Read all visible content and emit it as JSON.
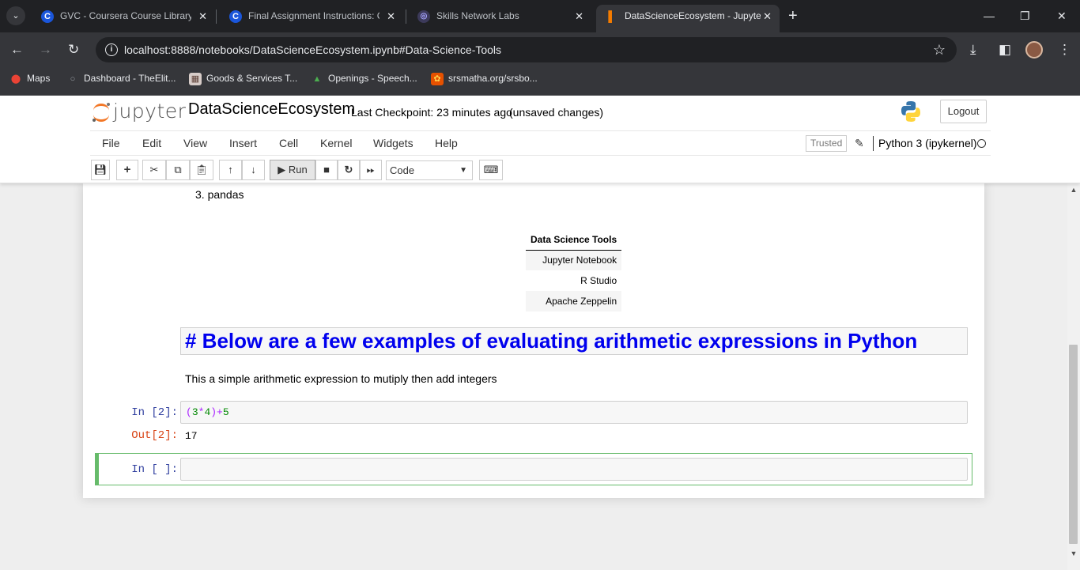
{
  "browser": {
    "tabs": [
      {
        "title": "GVC - Coursera Course Library |",
        "icon": "coursera-icon",
        "icon_glyph": "C"
      },
      {
        "title": "Final Assignment Instructions: C",
        "icon": "coursera-icon",
        "icon_glyph": "C"
      },
      {
        "title": "Skills Network Labs",
        "icon": "skills-network-icon",
        "icon_glyph": "◎"
      },
      {
        "title": "DataScienceEcosystem - Jupyter",
        "icon": "jupyter-tab-icon",
        "icon_glyph": "▌"
      }
    ],
    "url": "localhost:8888/notebooks/DataScienceEcosystem.ipynb#Data-Science-Tools",
    "bookmarks": [
      {
        "label": "Maps",
        "icon": "maps-icon"
      },
      {
        "label": "Dashboard - TheElit...",
        "icon": "search-icon"
      },
      {
        "label": "Goods & Services T...",
        "icon": "gst-icon"
      },
      {
        "label": "Openings - Speech...",
        "icon": "openings-icon"
      },
      {
        "label": "srsmatha.org/srsbo...",
        "icon": "srsmatha-icon"
      }
    ]
  },
  "jupyter": {
    "logo_text": "jupyter",
    "notebook_name": "DataScienceEcosystem",
    "checkpoint": "Last Checkpoint: 23 minutes ago",
    "autosave": "(unsaved changes)",
    "logout": "Logout",
    "menu": [
      "File",
      "Edit",
      "View",
      "Insert",
      "Cell",
      "Kernel",
      "Widgets",
      "Help"
    ],
    "trusted": "Trusted",
    "kernel": "Python 3 (ipykernel)",
    "run_label": "Run",
    "cell_type": "Code"
  },
  "notebook": {
    "list_item": "3. pandas",
    "table": {
      "header": "Data Science Tools",
      "rows": [
        "Jupyter Notebook",
        "R Studio",
        "Apache Zeppelin"
      ]
    },
    "heading": "# Below are a few examples of evaluating arithmetic expressions in Python",
    "markdown_text": "This a simple arithmetic expression to mutiply then add integers",
    "cell1": {
      "prompt": "In [2]:",
      "output_prompt": "Out[2]:",
      "output": "17"
    },
    "cell2": {
      "prompt": "In [ ]:"
    }
  },
  "colors": {
    "heading_text": "#0000ee",
    "selected_cell_border": "#66bb6a",
    "in_prompt": "#303f9f",
    "out_prompt": "#d84315"
  }
}
